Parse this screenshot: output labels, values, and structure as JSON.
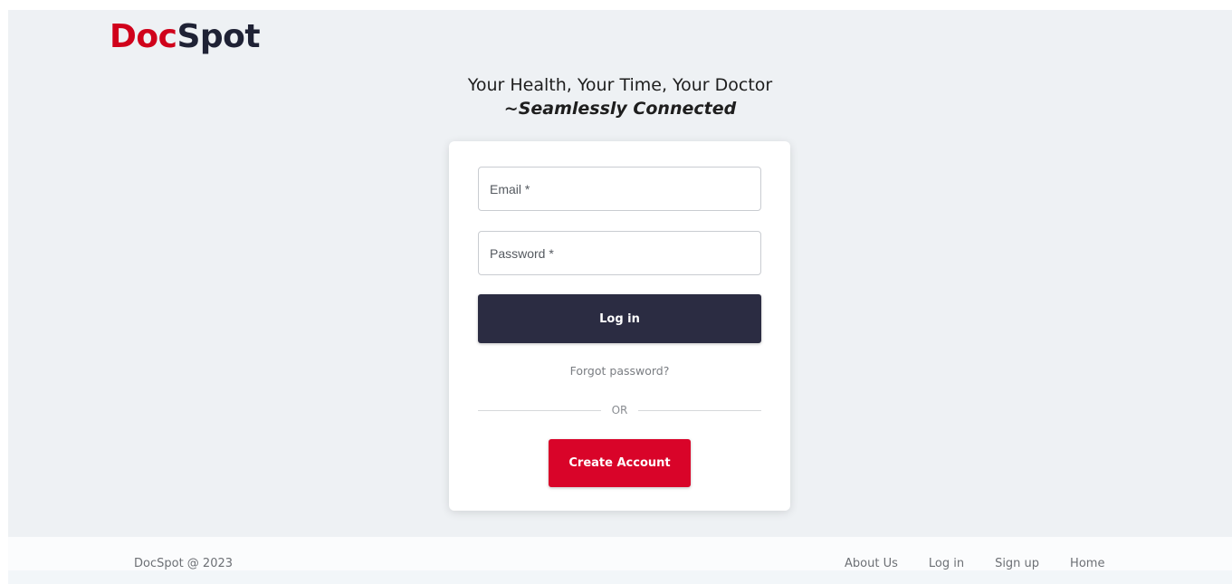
{
  "brand": {
    "part1": "Doc",
    "part2": "Spot",
    "colors": {
      "part1": "#d0021b",
      "part2": "#1f2235"
    }
  },
  "tagline": {
    "line1": "Your Health, Your Time, Your Doctor",
    "line2": "~Seamlessly Connected"
  },
  "login_form": {
    "email": {
      "placeholder": "Email *",
      "value": ""
    },
    "password": {
      "placeholder": "Password *",
      "value": ""
    },
    "login_label": "Log in",
    "forgot_label": "Forgot password?",
    "divider_label": "OR",
    "create_account_label": "Create Account",
    "colors": {
      "login_button": "#2b2c42",
      "create_button": "#d90429"
    }
  },
  "footer": {
    "copyright": "DocSpot @ 2023",
    "links": [
      {
        "label": "About Us"
      },
      {
        "label": "Log in"
      },
      {
        "label": "Sign up"
      },
      {
        "label": "Home"
      }
    ]
  }
}
